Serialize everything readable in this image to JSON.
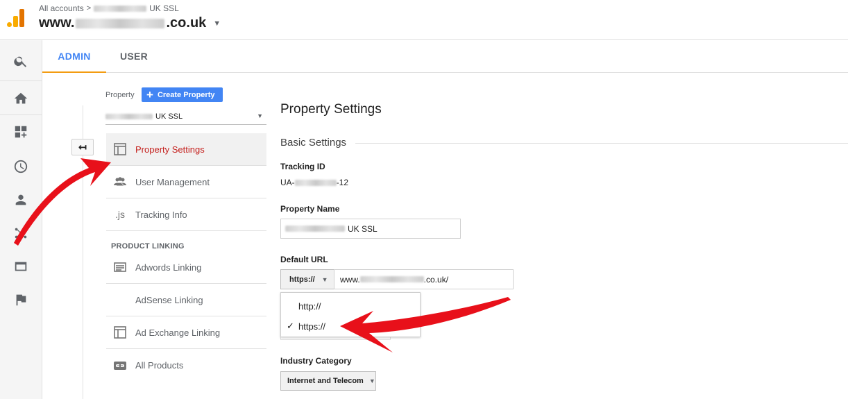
{
  "header": {
    "breadcrumb_root": "All accounts",
    "breadcrumb_sep": ">",
    "breadcrumb_suffix": "UK SSL",
    "title_prefix": "www.",
    "title_suffix": ".co.uk",
    "caret": "▼"
  },
  "tabs": [
    {
      "label": "ADMIN",
      "active": true
    },
    {
      "label": "USER",
      "active": false
    }
  ],
  "rail_icons": [
    "search-icon",
    "home-icon",
    "customization-icon",
    "realtime-icon",
    "audience-icon",
    "acquisition-icon",
    "behavior-icon",
    "conversions-icon"
  ],
  "property_panel": {
    "label": "Property",
    "create_button": "Create Property",
    "create_plus": "+",
    "selected_suffix": "UK SSL",
    "back_arrow": "↤",
    "menu": [
      {
        "label": "Property Settings",
        "icon": "layout-icon",
        "active": true
      },
      {
        "label": "User Management",
        "icon": "users-icon",
        "active": false
      },
      {
        "label": "Tracking Info",
        "icon": "js-icon",
        "active": false
      }
    ],
    "section_heading": "PRODUCT LINKING",
    "linking": [
      {
        "label": "Adwords Linking",
        "icon": "adwords-icon"
      },
      {
        "label": "AdSense Linking",
        "icon": "adsense-icon"
      },
      {
        "label": "Ad Exchange Linking",
        "icon": "layout-icon"
      },
      {
        "label": "All Products",
        "icon": "link-icon"
      }
    ],
    "js_glyph": ".js"
  },
  "settings": {
    "title": "Property Settings",
    "section": "Basic Settings",
    "tracking_id_label": "Tracking ID",
    "tracking_id_prefix": "UA-",
    "tracking_id_suffix": "-12",
    "property_name_label": "Property Name",
    "property_name_suffix": "UK SSL",
    "default_url_label": "Default URL",
    "protocol_selected": "https://",
    "url_prefix": "www.",
    "url_suffix": ".co.uk/",
    "protocol_options": [
      {
        "label": "http://",
        "checked": false
      },
      {
        "label": "https://",
        "checked": true
      }
    ],
    "check_glyph": "✓",
    "industry_label": "Industry Category",
    "industry_value": "Internet and Telecom"
  },
  "annotation_color": "#e8101a"
}
